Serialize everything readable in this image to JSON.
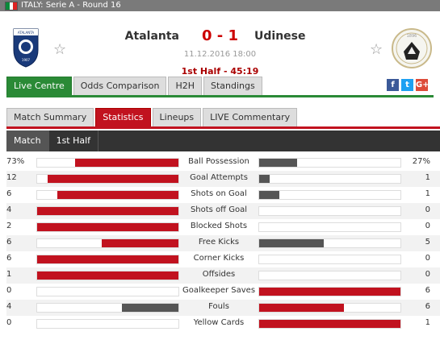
{
  "topbar": {
    "title": "ITALY: Serie A - Round 16"
  },
  "match": {
    "home": "Atalanta",
    "away": "Udinese",
    "score": "0 - 1",
    "date": "11.12.2016 18:00",
    "status": "1st Half - 45:19",
    "home_logo_text": "ATALANTA",
    "home_logo_year": "1907",
    "away_logo_year": "1896"
  },
  "tabs_main": [
    "Live Centre",
    "Odds Comparison",
    "H2H",
    "Standings"
  ],
  "tabs_sub": [
    "Match Summary",
    "Statistics",
    "Lineups",
    "LIVE Commentary"
  ],
  "period_tabs": [
    "Match",
    "1st Half"
  ],
  "social": [
    "f",
    "t",
    "G+"
  ],
  "colors": {
    "win": "#c1121f",
    "lose": "#555555",
    "green": "#2a8a36"
  },
  "stats": [
    {
      "label": "Ball Possession",
      "home": "73%",
      "away": "27%",
      "h": 0.73,
      "a": 0.27
    },
    {
      "label": "Goal Attempts",
      "home": "12",
      "away": "1",
      "h": 0.923,
      "a": 0.077
    },
    {
      "label": "Shots on Goal",
      "home": "6",
      "away": "1",
      "h": 0.857,
      "a": 0.143
    },
    {
      "label": "Shots off Goal",
      "home": "4",
      "away": "0",
      "h": 1.0,
      "a": 0.0
    },
    {
      "label": "Blocked Shots",
      "home": "2",
      "away": "0",
      "h": 1.0,
      "a": 0.0
    },
    {
      "label": "Free Kicks",
      "home": "6",
      "away": "5",
      "h": 0.545,
      "a": 0.455
    },
    {
      "label": "Corner Kicks",
      "home": "6",
      "away": "0",
      "h": 1.0,
      "a": 0.0
    },
    {
      "label": "Offsides",
      "home": "1",
      "away": "0",
      "h": 1.0,
      "a": 0.0
    },
    {
      "label": "Goalkeeper Saves",
      "home": "0",
      "away": "6",
      "h": 0.0,
      "a": 1.0
    },
    {
      "label": "Fouls",
      "home": "4",
      "away": "6",
      "h": 0.4,
      "a": 0.6
    },
    {
      "label": "Yellow Cards",
      "home": "0",
      "away": "1",
      "h": 0.0,
      "a": 1.0
    }
  ]
}
